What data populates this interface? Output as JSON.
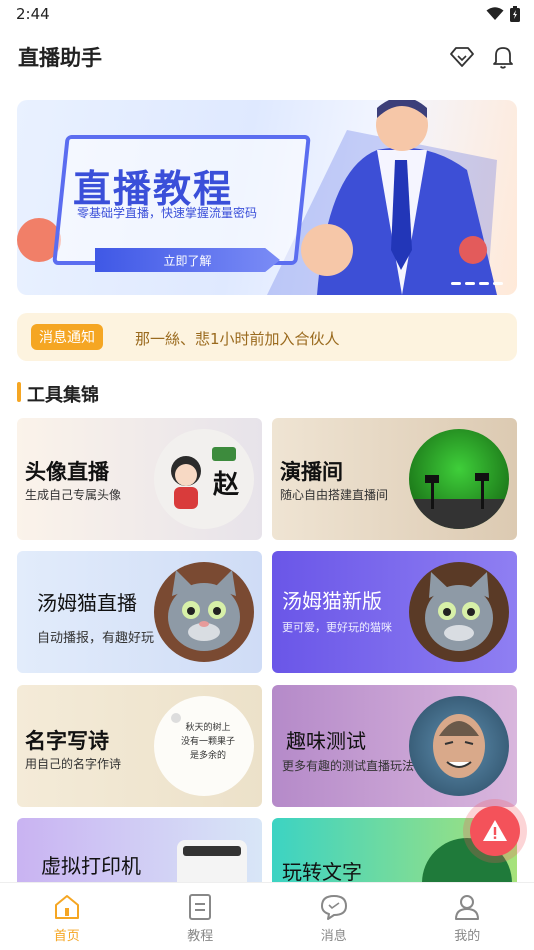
{
  "status_bar": {
    "time": "2:44"
  },
  "header": {
    "title": "直播助手",
    "icons": [
      "diamond-icon",
      "bell-icon"
    ]
  },
  "banner": {
    "title": "直播教程",
    "subtitle": "零基础学直播，快速掌握流量密码",
    "button_label": "立即了解"
  },
  "notice": {
    "tag": "消息通知",
    "text": "那一絲、悲1小时前加入合伙人"
  },
  "section": {
    "title": "工具集锦"
  },
  "tools": [
    {
      "title": "头像直播",
      "subtitle": "生成自己专属头像",
      "image_text": "赵"
    },
    {
      "title": "演播间",
      "subtitle": "随心自由搭建直播间"
    },
    {
      "title": "汤姆猫直播",
      "subtitle": "自动播报，有趣好玩"
    },
    {
      "title": "汤姆猫新版",
      "subtitle": "更可爱，更好玩的猫咪"
    },
    {
      "title": "名字写诗",
      "subtitle": "用自己的名字作诗",
      "poem_lines": [
        "秋天的树上",
        "没有一颗果子",
        "是多余的"
      ]
    },
    {
      "title": "趣味测试",
      "subtitle": "更多有趣的测试直播玩法"
    },
    {
      "title": "虚拟打印机",
      "subtitle": ""
    },
    {
      "title": "玩转文字",
      "subtitle": ""
    }
  ],
  "fab": {
    "icon": "warning-icon"
  },
  "bottom_nav": [
    {
      "label": "首页",
      "icon": "home-icon",
      "active": true
    },
    {
      "label": "教程",
      "icon": "document-icon",
      "active": false
    },
    {
      "label": "消息",
      "icon": "chat-icon",
      "active": false
    },
    {
      "label": "我的",
      "icon": "user-icon",
      "active": false
    }
  ],
  "colors": {
    "accent": "#f5a623",
    "banner_blue": "#3a4fd9",
    "fab": "#f4525a"
  }
}
